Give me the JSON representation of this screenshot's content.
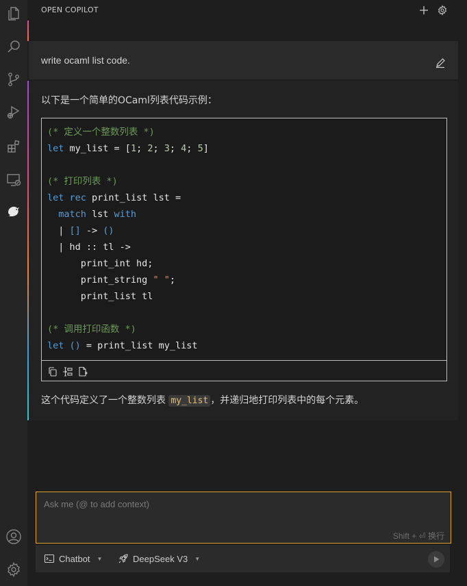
{
  "panel": {
    "title": "OPEN COPILOT"
  },
  "user_message": {
    "text": "write ocaml list code."
  },
  "assistant_message": {
    "intro": "以下是一个简单的OCaml列表代码示例：",
    "code_lines": [
      [
        {
          "t": "cm",
          "v": "(* 定义一个整数列表 *)"
        }
      ],
      [
        {
          "t": "kw",
          "v": "let"
        },
        {
          "t": "",
          "v": " my_list = ["
        },
        {
          "t": "nm",
          "v": "1"
        },
        {
          "t": "",
          "v": "; "
        },
        {
          "t": "nm",
          "v": "2"
        },
        {
          "t": "",
          "v": "; "
        },
        {
          "t": "nm",
          "v": "3"
        },
        {
          "t": "",
          "v": "; "
        },
        {
          "t": "nm",
          "v": "4"
        },
        {
          "t": "",
          "v": "; "
        },
        {
          "t": "nm",
          "v": "5"
        },
        {
          "t": "",
          "v": "]"
        }
      ],
      [],
      [
        {
          "t": "cm",
          "v": "(* 打印列表 *)"
        }
      ],
      [
        {
          "t": "kw",
          "v": "let"
        },
        {
          "t": "",
          "v": " "
        },
        {
          "t": "kw",
          "v": "rec"
        },
        {
          "t": "",
          "v": " print_list lst ="
        }
      ],
      [
        {
          "t": "",
          "v": "  "
        },
        {
          "t": "kw",
          "v": "match"
        },
        {
          "t": "",
          "v": " lst "
        },
        {
          "t": "kw",
          "v": "with"
        }
      ],
      [
        {
          "t": "",
          "v": "  | "
        },
        {
          "t": "kw",
          "v": "[]"
        },
        {
          "t": "",
          "v": " -> "
        },
        {
          "t": "kw",
          "v": "()"
        }
      ],
      [
        {
          "t": "",
          "v": "  | hd :: tl ->"
        }
      ],
      [
        {
          "t": "",
          "v": "      print_int hd;"
        }
      ],
      [
        {
          "t": "",
          "v": "      print_string "
        },
        {
          "t": "st",
          "v": "\" \""
        },
        {
          "t": "",
          "v": ";"
        }
      ],
      [
        {
          "t": "",
          "v": "      print_list tl"
        }
      ],
      [],
      [
        {
          "t": "cm",
          "v": "(* 调用打印函数 *)"
        }
      ],
      [
        {
          "t": "kw",
          "v": "let"
        },
        {
          "t": "",
          "v": " "
        },
        {
          "t": "kw",
          "v": "()"
        },
        {
          "t": "",
          "v": " = print_list my_list"
        }
      ]
    ],
    "outro_before": "这个代码定义了一个整数列表 ",
    "outro_code": "my_list",
    "outro_after": "，并递归地打印列表中的每个元素。"
  },
  "input": {
    "placeholder": "Ask me (@ to add context)",
    "shortcut_hint": "Shift + ⏎ 换行"
  },
  "footer": {
    "mode_label": "Chatbot",
    "model_label": "DeepSeek V3"
  },
  "colors": {
    "input_border": "#e5a32b",
    "comment": "#6a9955",
    "keyword": "#569cd6",
    "number": "#b5cea8"
  },
  "icons": {
    "activity": [
      "explorer-icon",
      "search-icon",
      "source-control-icon",
      "run-debug-icon",
      "extensions-icon",
      "remote-explorer-icon",
      "copilot-bird-icon",
      "account-icon",
      "manage-gear-icon"
    ],
    "header": [
      "plus-icon",
      "gear-icon"
    ],
    "code_toolbar": [
      "copy-icon",
      "insert-at-cursor-icon",
      "new-file-icon"
    ]
  }
}
